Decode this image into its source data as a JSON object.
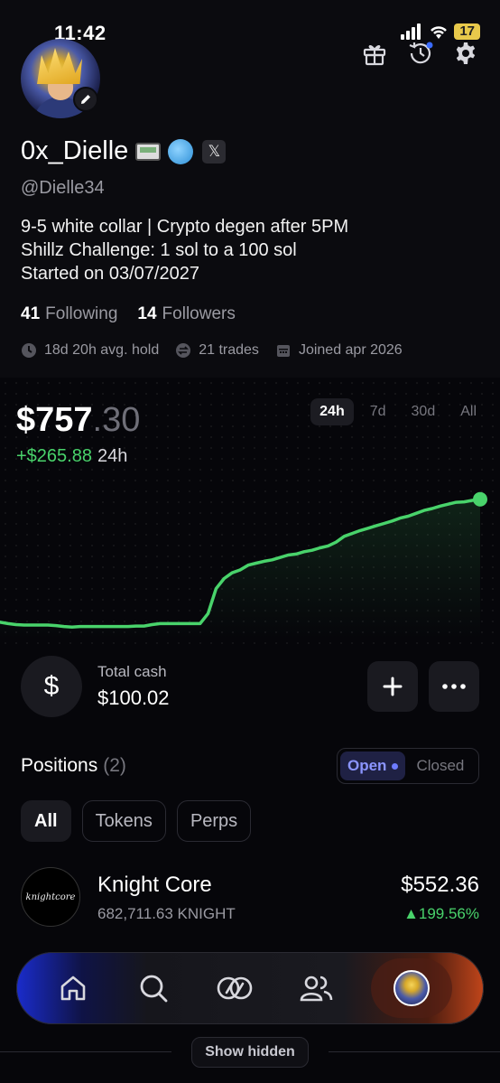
{
  "status": {
    "time": "11:42",
    "battery": "17"
  },
  "profile": {
    "name": "0x_Dielle",
    "handle": "@Dielle34",
    "bio": [
      "9-5 white collar | Crypto degen after 5PM",
      "Shillz Challenge: 1 sol to a 100 sol",
      "Started on 03/07/2027"
    ],
    "following_count": "41",
    "following_label": "Following",
    "followers_count": "14",
    "followers_label": "Followers",
    "meta": {
      "avg_hold": "18d 20h avg. hold",
      "trades": "21 trades",
      "joined": "Joined apr 2026"
    }
  },
  "portfolio": {
    "value_main": "$757",
    "value_cents": ".30",
    "change": "+$265.88",
    "change_period": "24h",
    "ranges": [
      "24h",
      "7d",
      "30d",
      "All"
    ],
    "active_range": "24h",
    "accent_color": "#49d36b"
  },
  "chart_data": {
    "type": "line",
    "title": "",
    "xlabel": "",
    "ylabel": "",
    "x": [
      0,
      1,
      2,
      3,
      4,
      5,
      6,
      7,
      8,
      9,
      10,
      11,
      12,
      13,
      14,
      15,
      16,
      17,
      18,
      19,
      20,
      21,
      22,
      23,
      24,
      25,
      26,
      27,
      28,
      29,
      30,
      31,
      32,
      33,
      34,
      35,
      36,
      37,
      38,
      39,
      40,
      41,
      42,
      43,
      44,
      45,
      46,
      47,
      48,
      49,
      50,
      51,
      52,
      53,
      54,
      55,
      56,
      57,
      58,
      59,
      60
    ],
    "values": [
      501,
      498,
      496,
      495,
      495,
      495,
      495,
      494,
      492,
      491,
      492,
      492,
      492,
      492,
      492,
      492,
      492,
      493,
      493,
      496,
      498,
      498,
      498,
      498,
      498,
      498,
      519,
      571,
      592,
      604,
      610,
      620,
      624,
      628,
      631,
      636,
      641,
      643,
      648,
      651,
      656,
      660,
      668,
      680,
      686,
      692,
      697,
      702,
      707,
      712,
      718,
      722,
      728,
      734,
      738,
      743,
      747,
      751,
      752,
      755,
      757.3
    ],
    "ylim": [
      480,
      770
    ],
    "grid": false
  },
  "cash": {
    "label": "Total cash",
    "value": "$100.02",
    "icon": "dollar-icon"
  },
  "positions": {
    "title": "Positions",
    "count": "(2)",
    "open_label": "Open",
    "closed_label": "Closed",
    "filters": [
      "All",
      "Tokens",
      "Perps"
    ],
    "items": [
      {
        "name": "Knight Core",
        "amount": "682,711.63 KNIGHT",
        "value": "$552.36",
        "change": "▲199.56%",
        "logo_text": "knightcore"
      }
    ],
    "hidden_label": "Show hidden"
  },
  "nav": {
    "items": [
      "home-icon",
      "search-icon",
      "trade-icon",
      "people-icon",
      "profile-avatar"
    ]
  }
}
